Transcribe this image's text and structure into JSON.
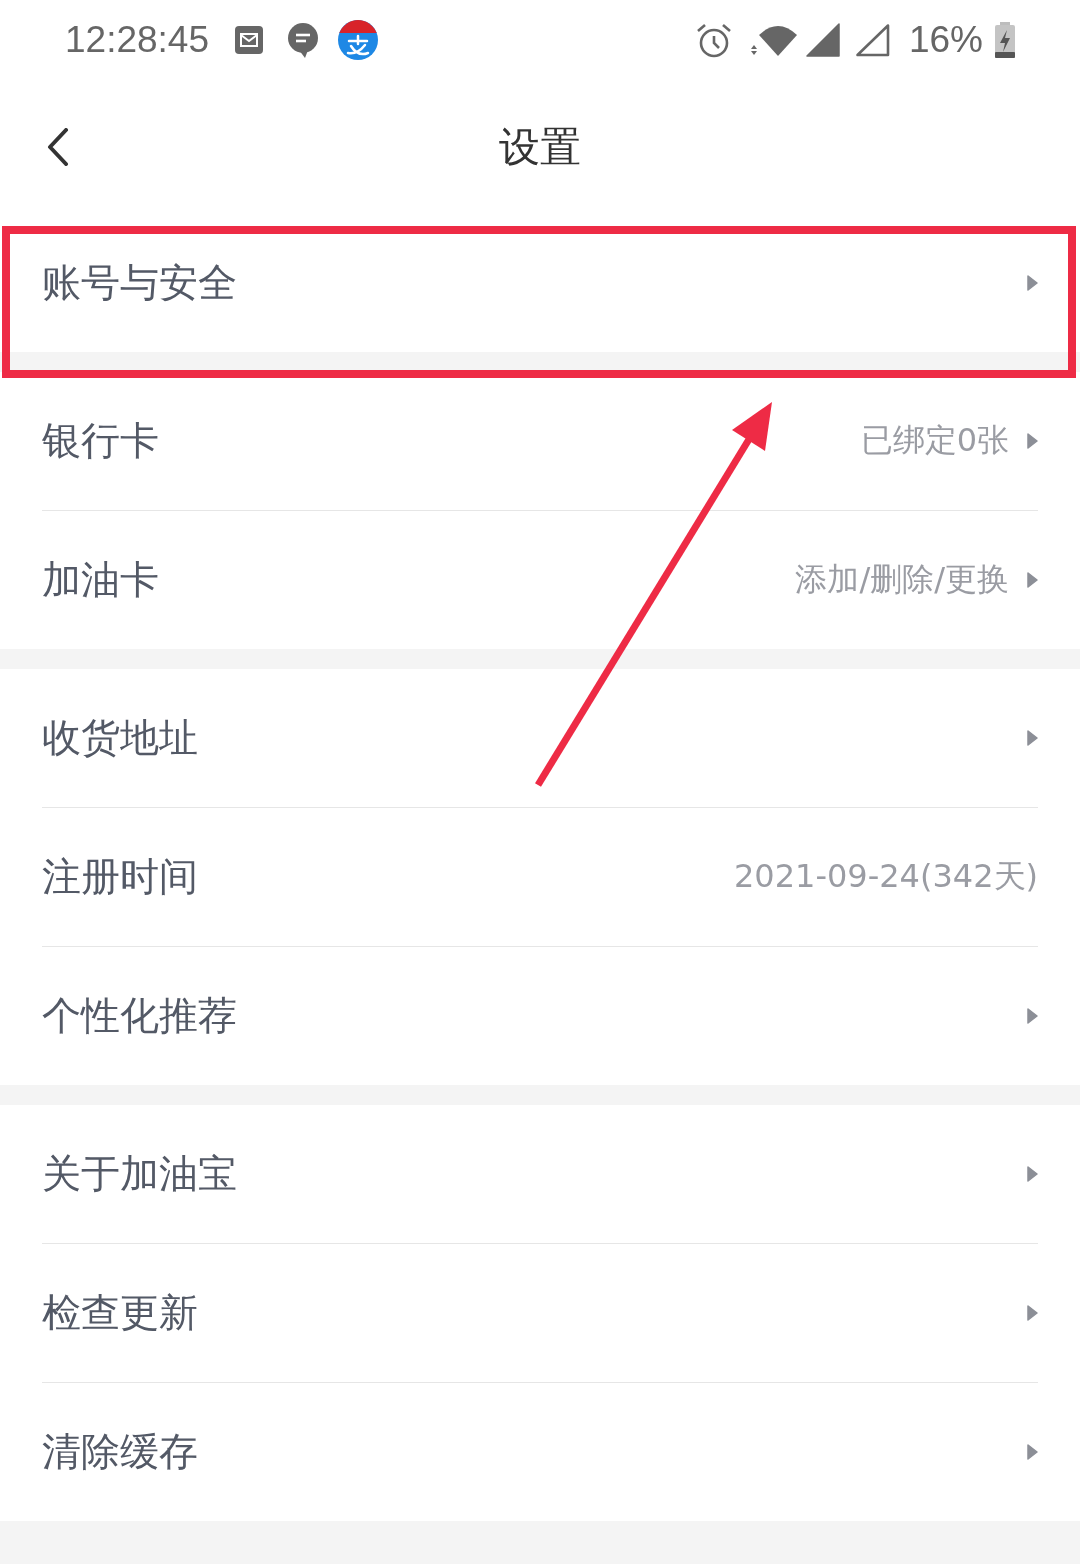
{
  "status_bar": {
    "time": "12:28:45",
    "battery": "16%"
  },
  "header": {
    "title": "设置"
  },
  "sections": [
    {
      "items": [
        {
          "label": "账号与安全",
          "chevron": true,
          "highlighted": true
        }
      ]
    },
    {
      "items": [
        {
          "label": "银行卡",
          "value": "已绑定0张",
          "chevron": true,
          "highlighted": false
        },
        {
          "label": "加油卡",
          "value": "添加/删除/更换",
          "chevron": true,
          "highlighted": false
        }
      ]
    },
    {
      "items": [
        {
          "label": "收货地址",
          "chevron": true,
          "highlighted": false
        },
        {
          "label": "注册时间",
          "value": "2021-09-24(342天)",
          "chevron": false,
          "highlighted": false
        },
        {
          "label": "个性化推荐",
          "chevron": true,
          "highlighted": false
        }
      ]
    },
    {
      "items": [
        {
          "label": "关于加油宝",
          "chevron": true,
          "highlighted": false
        },
        {
          "label": "检查更新",
          "chevron": true,
          "highlighted": false
        },
        {
          "label": "清除缓存",
          "chevron": true,
          "highlighted": false
        }
      ]
    }
  ]
}
